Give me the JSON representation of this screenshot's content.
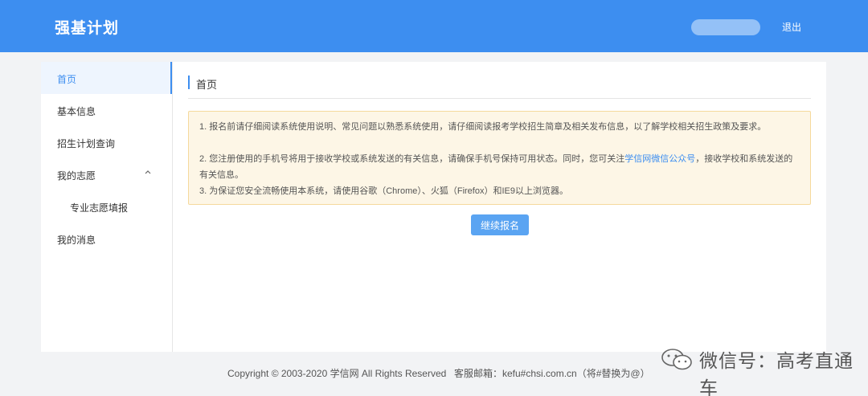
{
  "header": {
    "app_title": "强基计划",
    "logout_label": "退出"
  },
  "sidebar": {
    "items": [
      {
        "label": "首页",
        "active": true
      },
      {
        "label": "基本信息"
      },
      {
        "label": "招生计划查询"
      },
      {
        "label": "我的志愿",
        "expanded": true,
        "icon": "chevron-up-icon"
      },
      {
        "label": "专业志愿填报",
        "sub": true
      },
      {
        "label": "我的消息"
      }
    ]
  },
  "main": {
    "page_title": "首页",
    "notice": {
      "line1": "1. 报名前请仔细阅读系统使用说明、常见问题以熟悉系统使用，请仔细阅读报考学校招生简章及相关发布信息，以了解学校相关招生政策及要求。",
      "line2_before": "2. 您注册使用的手机号将用于接收学校或系统发送的有关信息，请确保手机号保持可用状态。同时，您可关注",
      "line2_link": "学信网微信公众号",
      "line2_after": "，接收学校和系统发送的有关信息。",
      "line3": "3. 为保证您安全流畅使用本系统，请使用谷歌（Chrome）、火狐（Firefox）和IE9以上浏览器。"
    },
    "continue_button": "继续报名"
  },
  "footer": {
    "copyright": "Copyright © 2003-2020 学信网 All Rights Reserved",
    "email": "客服邮箱：kefu#chsi.com.cn（将#替换为@）"
  },
  "watermark": {
    "text": "微信号：高考直通车",
    "icon": "wechat-icon"
  },
  "colors": {
    "primary": "#3d8ef0",
    "notice_bg": "#fdf6e6",
    "notice_border": "#f5d99c"
  }
}
